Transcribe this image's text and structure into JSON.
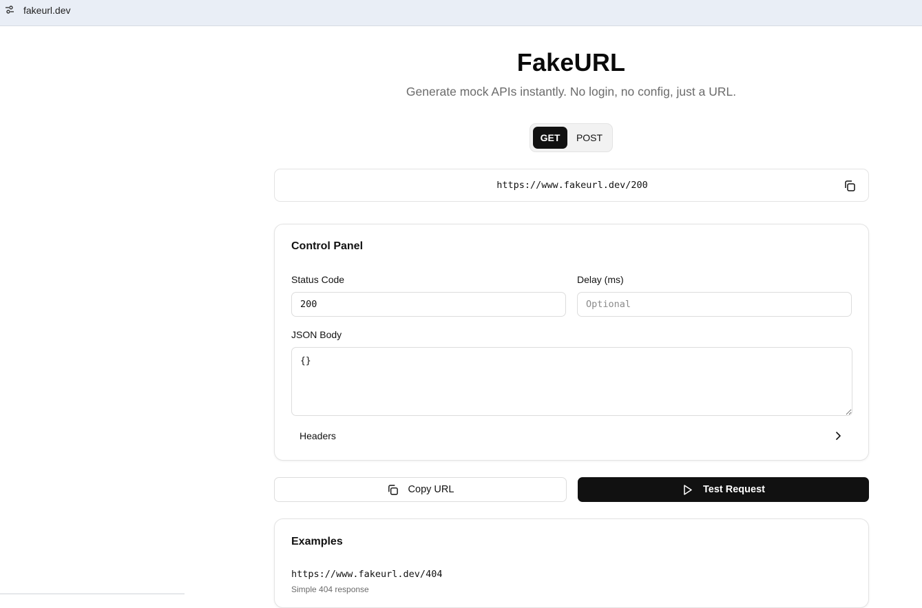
{
  "browser": {
    "address": "fakeurl.dev",
    "site_info_icon": "tune-icon"
  },
  "header": {
    "title": "FakeURL",
    "subtitle": "Generate mock APIs instantly. No login, no config, just a URL."
  },
  "method_toggle": {
    "options": [
      "GET",
      "POST"
    ],
    "selected": "GET"
  },
  "url_display": {
    "url": "https://www.fakeurl.dev/200",
    "copy_icon": "copy-icon"
  },
  "control_panel": {
    "title": "Control Panel",
    "status_code": {
      "label": "Status Code",
      "value": "200"
    },
    "delay": {
      "label": "Delay (ms)",
      "value": "",
      "placeholder": "Optional"
    },
    "json_body": {
      "label": "JSON Body",
      "value": "{}"
    },
    "headers": {
      "label": "Headers",
      "icon": "chevron-right-icon"
    }
  },
  "actions": {
    "copy_label": "Copy URL",
    "copy_icon": "copy-icon",
    "test_label": "Test Request",
    "test_icon": "play-icon"
  },
  "examples": {
    "title": "Examples",
    "items": [
      {
        "url": "https://www.fakeurl.dev/404",
        "description": "Simple 404 response"
      }
    ]
  },
  "colors": {
    "primary": "#111111",
    "muted_text": "#6b6b6b",
    "border": "#e3e3e3",
    "browser_bar": "#e9eef6"
  }
}
